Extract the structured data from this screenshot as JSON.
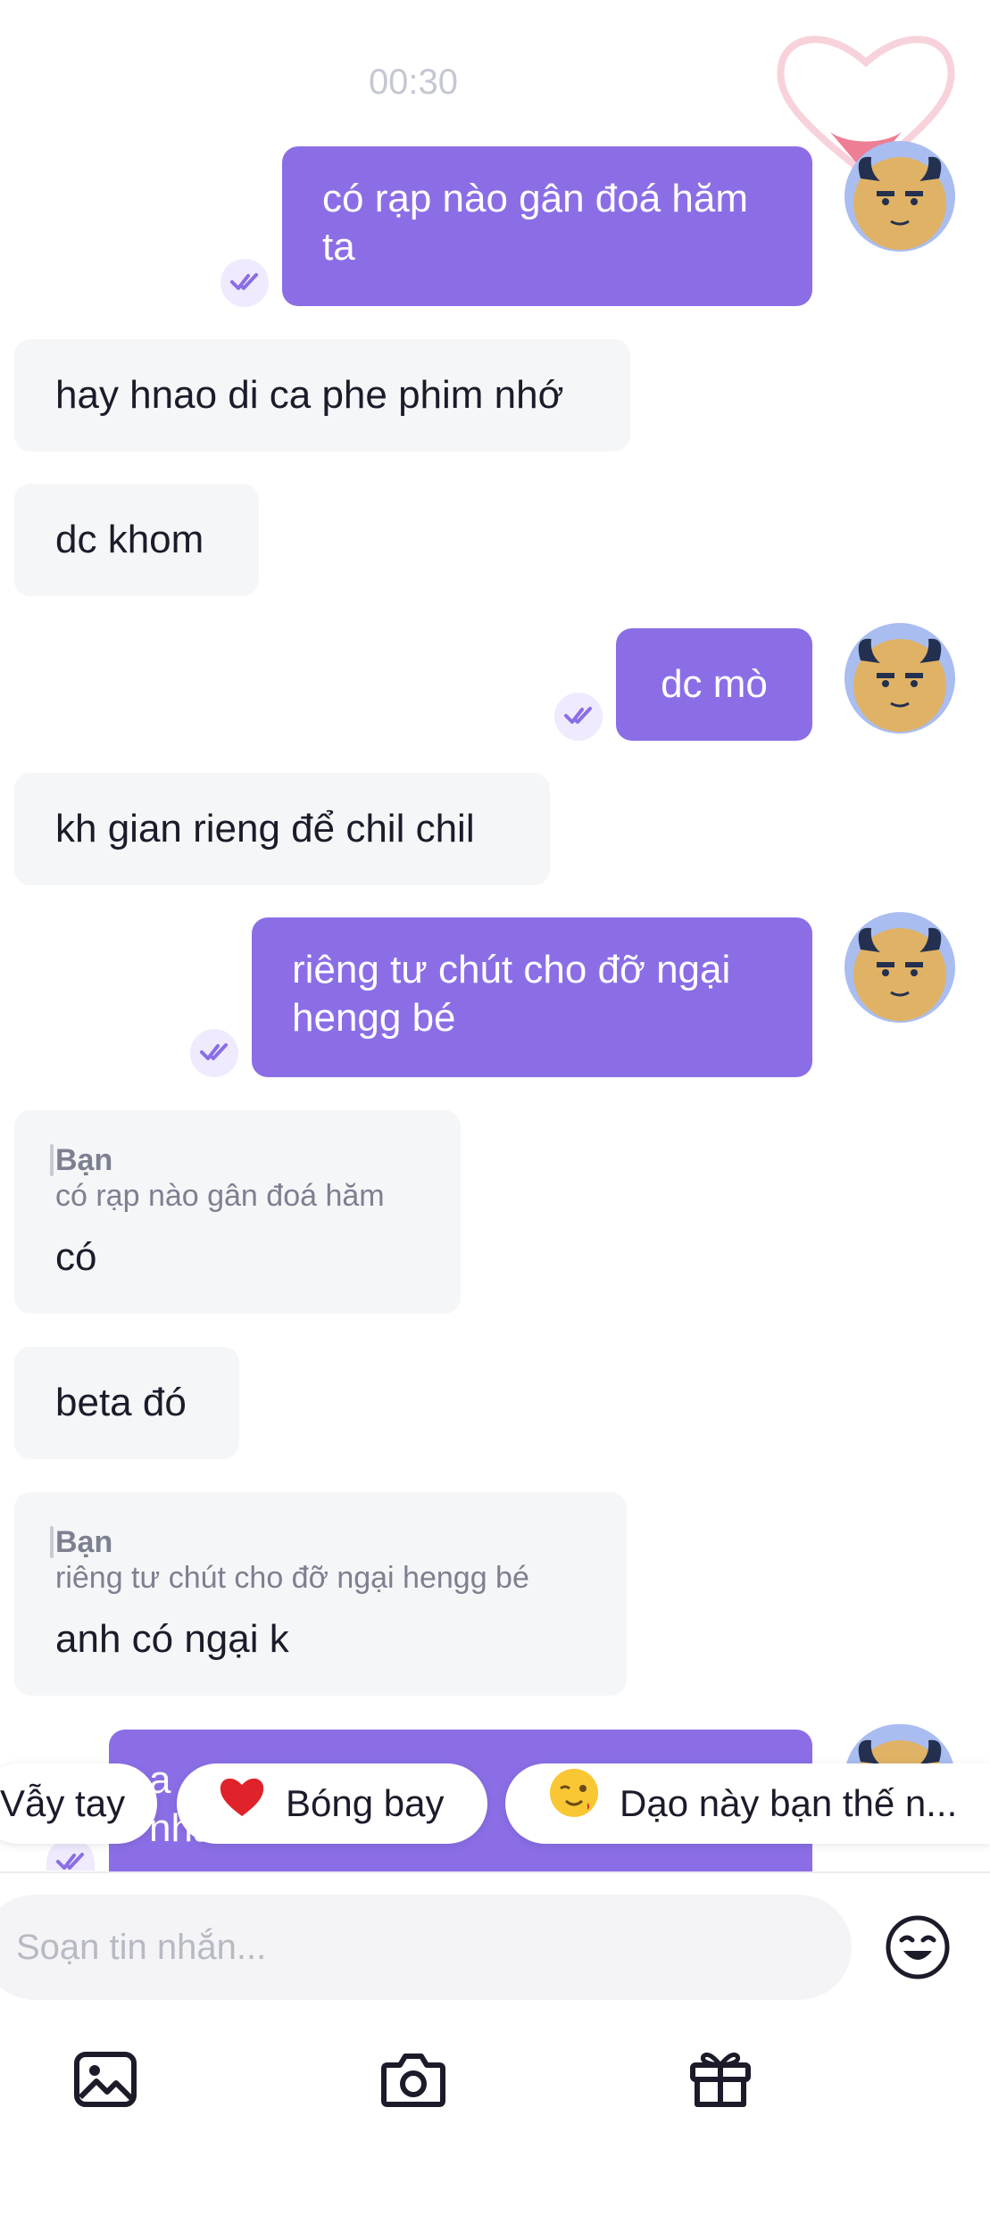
{
  "chat": {
    "timestamp": "00:30",
    "messages": [
      {
        "dir": "out",
        "lines": [
          "có rạp nào gân đoá hăm",
          "ta"
        ],
        "read": true
      },
      {
        "dir": "in",
        "text": "hay hnao di ca phe phim nhớ"
      },
      {
        "dir": "in",
        "text": "dc khom"
      },
      {
        "dir": "out",
        "lines": [
          "dc mò"
        ],
        "read": true
      },
      {
        "dir": "in",
        "text": "kh gian rieng để chil chil"
      },
      {
        "dir": "out",
        "lines": [
          "riêng tư chút cho đỡ ngại",
          "hengg bé"
        ],
        "read": true
      },
      {
        "dir": "in",
        "quote": {
          "sender": "Bạn",
          "text": "có rạp nào gân đoá hăm"
        },
        "text": "có"
      },
      {
        "dir": "in",
        "text": "beta đó"
      },
      {
        "dir": "in",
        "quote": {
          "sender": "Bạn",
          "text": "riêng tư chút cho đỡ ngại hengg bé"
        },
        "text": "anh có ngại k"
      },
      {
        "dir": "out",
        "lines": [
          "a",
          "nhất ồ"
        ],
        "read": true,
        "partially_hidden": true
      }
    ]
  },
  "quick_replies": [
    {
      "label": "Vẫy tay",
      "emoji": ""
    },
    {
      "label": "Bóng bay",
      "emoji": "heart"
    },
    {
      "label": "Dạo này bạn thế n...",
      "emoji": "winking-face"
    }
  ],
  "composer": {
    "placeholder": "Soạn tin nhắn...",
    "emoji_button": "smiley-icon"
  },
  "toolbar": {
    "items": [
      "image-icon",
      "camera-icon",
      "gift-icon"
    ]
  },
  "colors": {
    "outgoing_bubble": "#8b6ee6",
    "incoming_bubble": "#f5f6f8",
    "read_tick": "#8b6ee6"
  }
}
